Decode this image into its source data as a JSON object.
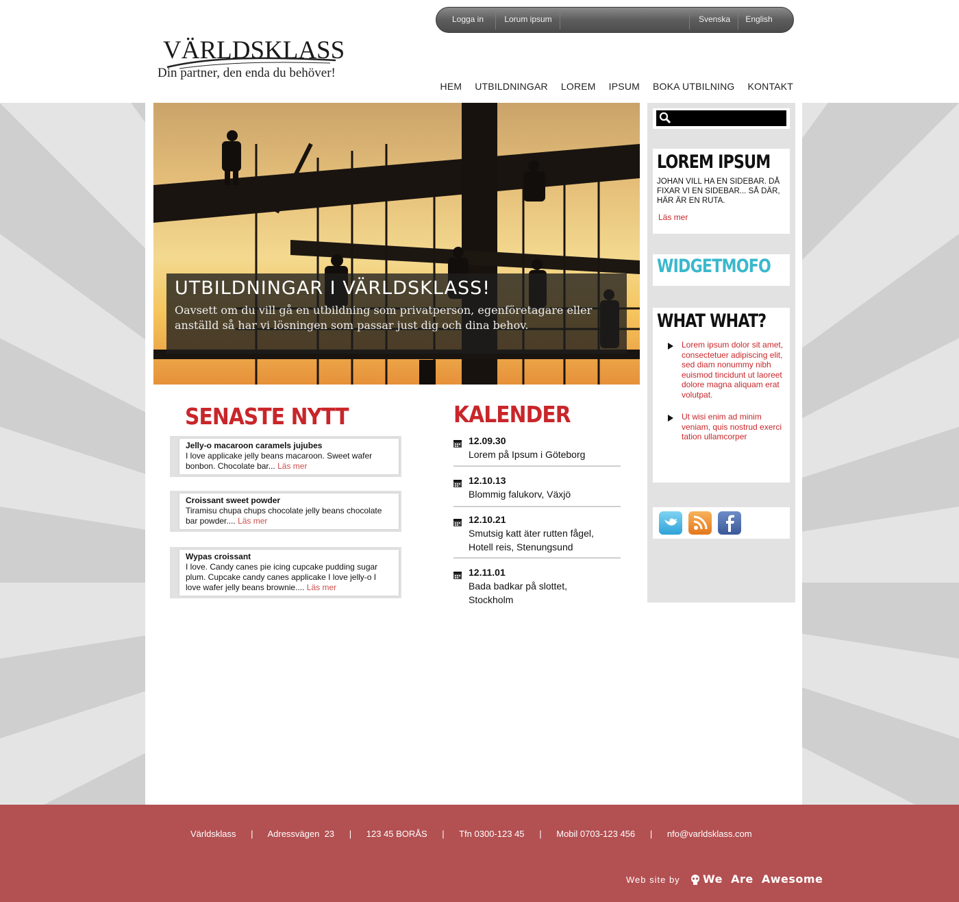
{
  "topbar": {
    "login": "Logga in",
    "lorum": "Lorum ipsum",
    "lang_sv": "Svenska",
    "lang_en": "English"
  },
  "logo": {
    "wordmark": "VÄRLDSKLASS",
    "tagline": "Din partner, den enda du behöver!"
  },
  "nav": [
    "HEM",
    "UTBILDNINGAR",
    "LOREM",
    "IPSUM",
    "BOKA UTBILNING",
    "KONTAKT"
  ],
  "hero": {
    "title": "UTBILDNINGAR I VÄRLDSKLASS!",
    "text": "Oavsett om du vill gå en utbildning som privatperson, egenföretagare eller anställd så har vi lösningen som passar just dig och dina behov."
  },
  "news": {
    "heading": "SENASTE NYTT",
    "more_label": "Läs mer",
    "items": [
      {
        "title": "Jelly-o macaroon caramels jujubes",
        "text": "I love applicake jelly beans macaroon. Sweet wafer bonbon. Chocolate bar..."
      },
      {
        "title": "Croissant sweet powder",
        "text": "Tiramisu chupa chups chocolate jelly beans chocolate bar powder...."
      },
      {
        "title": "Wypas croissant",
        "text": "I love. Candy canes pie icing cupcake pudding sugar plum. Cupcake candy canes applicake I love jelly-o I love wafer jelly beans brownie...."
      }
    ]
  },
  "calendar": {
    "heading": "KALENDER",
    "items": [
      {
        "date": "12.09.30",
        "event": "Lorem på Ipsum i Göteborg"
      },
      {
        "date": "12.10.13",
        "event": "Blommig falukorv, Växjö"
      },
      {
        "date": "12.10.21",
        "event": "Smutsig katt äter rutten fågel, Hotell reis, Stenungsund"
      },
      {
        "date": "12.11.01",
        "event": "Bada badkar på slottet, Stockholm"
      }
    ]
  },
  "sidebar": {
    "search_placeholder": "",
    "lorem": {
      "heading": "LOREM IPSUM",
      "text": "JOHAN VILL HA EN SIDEBAR. DÅ FIXAR VI EN SIDEBAR... SÅ DÄR, HÄR ÄR EN RUTA.",
      "more": "Läs mer"
    },
    "widget": {
      "heading": "WIDGETMOFO",
      "color": "#3bb8cc"
    },
    "whatwhat": {
      "heading": "WHAT WHAT?",
      "items": [
        "Lorem ipsum dolor sit amet, consectetuer adipiscing elit, sed diam nonummy nibh euismod tincidunt ut laoreet dolore magna aliquam erat volutpat.",
        "Ut wisi enim ad minim veniam, quis nostrud exerci tation ullamcorper"
      ]
    },
    "social": [
      "twitter-icon",
      "rss-icon",
      "facebook-icon"
    ]
  },
  "footer": {
    "line": "Världsklass      |      Adressvägen  23      |      123 45 BORÅS      |      Tfn 0300-123 45      |      Mobil 0703-123 456      |      nfo@varldsklass.com",
    "credit": "Web site by",
    "brand": "We  Are  Awesome"
  },
  "colors": {
    "accent_red": "#c8262a",
    "footer_bg": "#b35052",
    "widget_cyan": "#3bb8cc"
  }
}
